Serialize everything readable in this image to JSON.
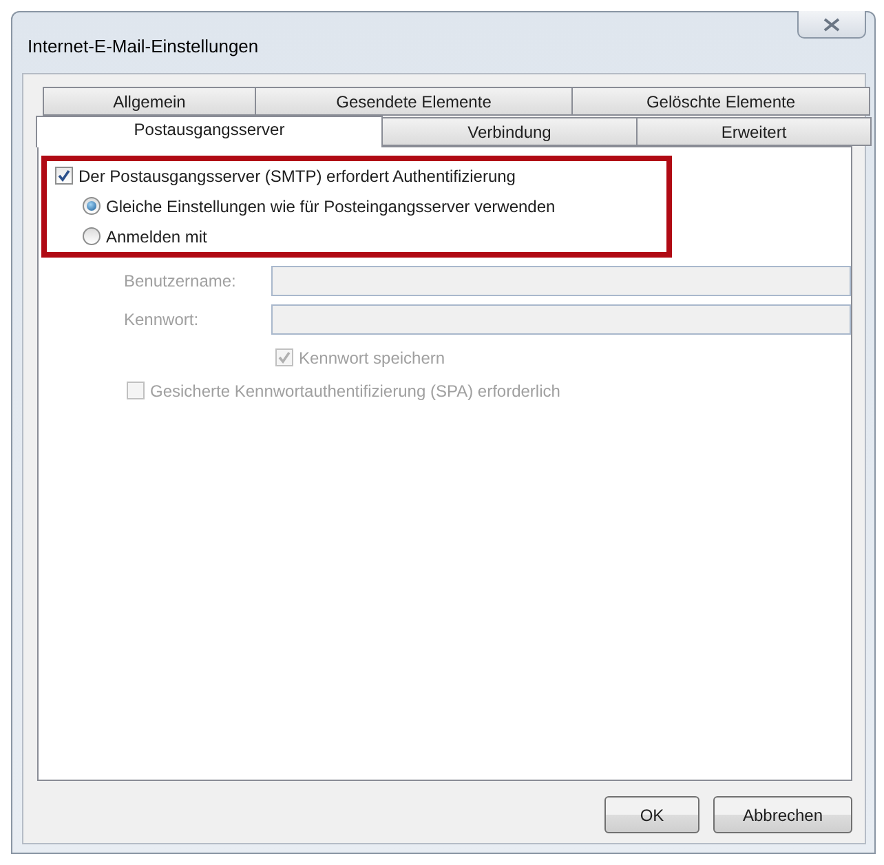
{
  "window": {
    "title": "Internet-E-Mail-Einstellungen"
  },
  "tab_rows": [
    [
      {
        "label": "Allgemein",
        "selected": false
      },
      {
        "label": "Gesendete Elemente",
        "selected": false
      },
      {
        "label": "Gelöschte Elemente",
        "selected": false
      }
    ],
    [
      {
        "label": "Postausgangsserver",
        "selected": true
      },
      {
        "label": "Verbindung",
        "selected": false
      },
      {
        "label": "Erweitert",
        "selected": false
      }
    ]
  ],
  "auth_checkbox": {
    "label": "Der Postausgangsserver (SMTP) erfordert Authentifizierung",
    "checked": true
  },
  "login_options": [
    {
      "label": "Gleiche Einstellungen wie für Posteingangsserver verwenden",
      "selected": true
    },
    {
      "label": "Anmelden mit",
      "selected": false
    }
  ],
  "fields": [
    {
      "label": "Benutzername:",
      "disabled": true
    },
    {
      "label": "Kennwort:",
      "disabled": true
    }
  ],
  "remember_password": {
    "label": "Kennwort speichern",
    "checked": true,
    "disabled": true
  },
  "spa": {
    "label": "Gesicherte Kennwortauthentifizierung (SPA) erforderlich",
    "checked": false,
    "disabled": true
  },
  "buttons": [
    "OK",
    "Abbrechen"
  ]
}
